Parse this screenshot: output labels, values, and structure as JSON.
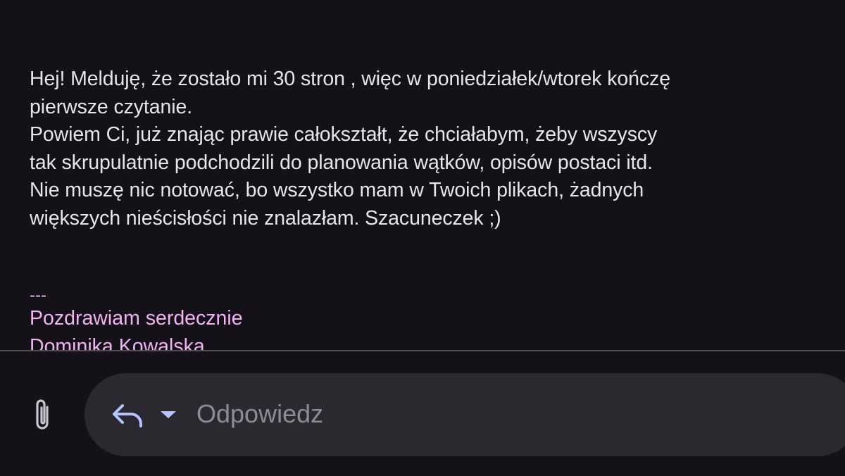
{
  "message": {
    "lines": [
      "Hej! Melduję, że zostało mi 30 stron , więc w poniedziałek/wtorek kończę",
      "pierwsze czytanie.",
      "Powiem Ci, już znając prawie całokształt, że chciałabym, żeby wszyscy",
      "tak skrupulatnie podchodzili do planowania wątków, opisów postaci itd.",
      "Nie muszę nic notować, bo wszystko mam w Twoich plikach, żadnych",
      "większych nieścisłości nie znalazłam. Szacuneczek ;)"
    ],
    "signature": {
      "separator": "---",
      "greeting": "Pozdrawiam serdecznie",
      "name_partial": "Dominika Kowalska"
    }
  },
  "reply_bar": {
    "placeholder": "Odpowiedz",
    "attach_icon": "paperclip-icon",
    "reply_icon": "reply-arrow-icon",
    "dropdown_icon": "dropdown-triangle-icon"
  },
  "colors": {
    "background": "#141218",
    "body_text": "#e8e4ec",
    "signature_text": "#f1b3f1",
    "pill_background": "#2b2930",
    "icon_color": "#b4c5ff",
    "placeholder_text": "#8f8b96",
    "divider": "#55515b"
  }
}
